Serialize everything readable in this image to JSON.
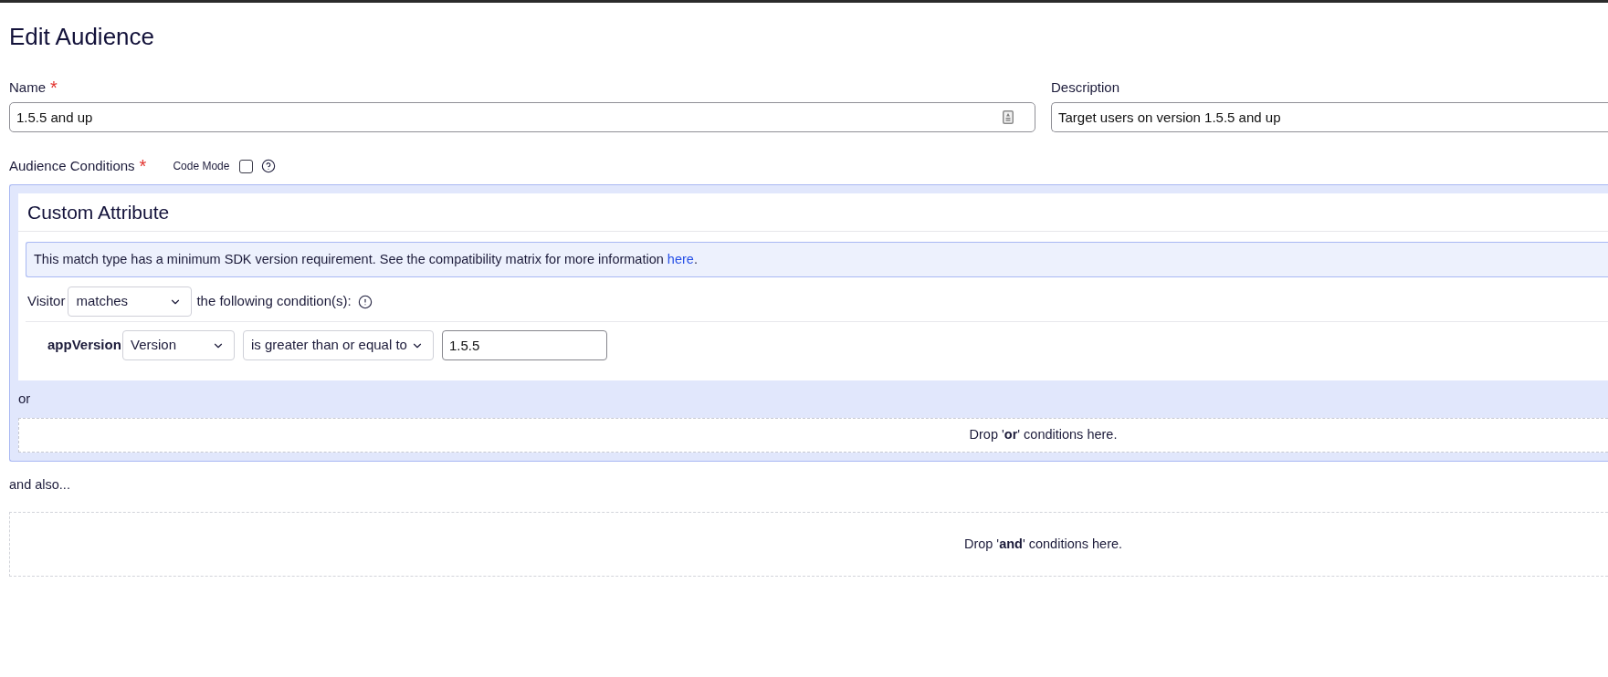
{
  "page_title": "Edit Audience",
  "name_field": {
    "label": "Name",
    "required_mark": "*",
    "value": "1.5.5 and up"
  },
  "description_field": {
    "label": "Description",
    "value": "Target users on version 1.5.5 and up"
  },
  "audience_conditions": {
    "label": "Audience Conditions",
    "required_mark": "*",
    "code_mode": {
      "label": "Code Mode",
      "checked": false
    },
    "or_group": {
      "card": {
        "title": "Custom Attribute",
        "notice": "This match type has a minimum SDK version requirement. See the compatibility matrix for more information ",
        "notice_link": "here",
        "notice_end": ".",
        "visitor": {
          "label": "Visitor",
          "match": "matches",
          "suffix": "the following condition(s):"
        },
        "conditions": [
          {
            "attribute": "appVersion",
            "type": "Version",
            "operator": "is greater than or equal to",
            "value": "1.5.5"
          }
        ]
      },
      "or_label": "or",
      "or_drop_zone": "Drop '**or**' conditions here."
    },
    "and_label": "and also...",
    "and_drop_zone": "Drop '**and**' conditions here."
  }
}
